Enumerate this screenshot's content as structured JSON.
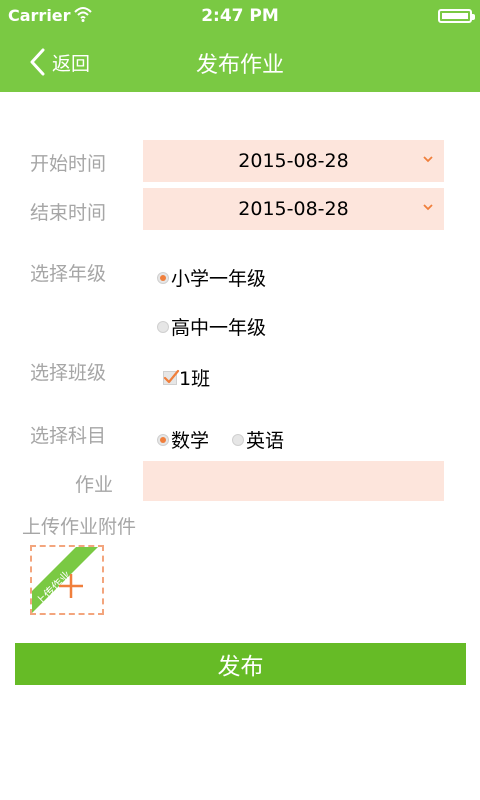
{
  "status_bar": {
    "carrier": "Carrier",
    "time": "2:47 PM"
  },
  "nav": {
    "back_label": "返回",
    "title": "发布作业"
  },
  "form": {
    "start_time": {
      "label": "开始时间",
      "value": "2015-08-28"
    },
    "end_time": {
      "label": "结束时间",
      "value": "2015-08-28"
    },
    "grade": {
      "label": "选择年级",
      "options": [
        {
          "label": "小学一年级",
          "selected": true
        },
        {
          "label": "高中一年级",
          "selected": false
        }
      ]
    },
    "class": {
      "label": "选择班级",
      "options": [
        {
          "label": "1班",
          "checked": true
        }
      ]
    },
    "subject": {
      "label": "选择科目",
      "options": [
        {
          "label": "数学",
          "selected": true
        },
        {
          "label": "英语",
          "selected": false
        }
      ]
    },
    "homework": {
      "label": "作业",
      "value": ""
    },
    "attachment": {
      "label": "上传作业附件",
      "upload_ribbon": "上传作业"
    },
    "submit_label": "发布"
  },
  "colors": {
    "header": "#7ac943",
    "accent": "#f07f3c",
    "field_bg": "#fde5dc",
    "button": "#66bb26"
  }
}
